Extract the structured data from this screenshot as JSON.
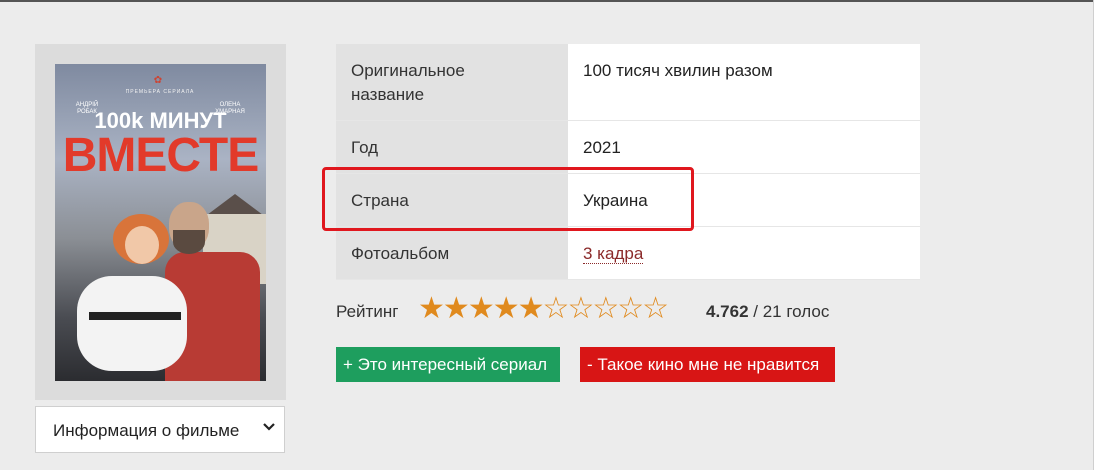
{
  "poster": {
    "title_line1": "100k МИНУТ",
    "title_line2": "ВМЕСТЕ",
    "actor_left": "АНДРІЙ РОБАК",
    "actor_right": "ОЛЕНА ХМАРНАЯ",
    "tagline": "ПРЕМЬЕРА СЕРИАЛА"
  },
  "info_select": {
    "label": "Информация о фильме",
    "icon": "chevron-down-icon"
  },
  "details": [
    {
      "key": "Оригинальное название",
      "value": "100 тисяч хвилин разом"
    },
    {
      "key": "Год",
      "value": "2021"
    },
    {
      "key": "Страна",
      "value": "Украина"
    },
    {
      "key": "Фотоальбом",
      "value": "3 кадра"
    }
  ],
  "rating": {
    "label": "Рейтинг",
    "score": "4.762",
    "votes": "/ 21 голос",
    "stars_filled": 5,
    "stars_total": 10,
    "star_color": "#e08a1e"
  },
  "buttons": {
    "like": "+ Это интересный сериал",
    "dislike": "- Такое кино мне не нравится",
    "like_color": "#1e9e5e",
    "dislike_color": "#d81515"
  },
  "highlight_color": "#e0171e"
}
